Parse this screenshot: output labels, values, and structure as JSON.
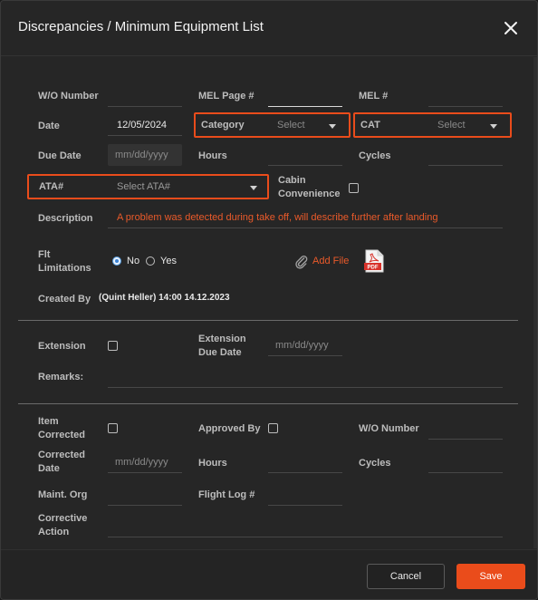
{
  "modal": {
    "title": "Discrepancies / Minimum Equipment List",
    "close_icon": "close-icon"
  },
  "form": {
    "wo_number_label": "W/O Number",
    "mel_page_label": "MEL Page #",
    "mel_number_label": "MEL #",
    "date_label": "Date",
    "date_value": "12/05/2024",
    "category_label": "Category",
    "category_value": "Select",
    "cat_label": "CAT",
    "cat_value": "Select",
    "due_date_label": "Due Date",
    "due_date_placeholder": "mm/dd/yyyy",
    "hours_label": "Hours",
    "cycles_label": "Cycles",
    "ata_label": "ATA#",
    "ata_value": "Select ATA#",
    "cabin_label": "Cabin Convenience",
    "description_label": "Description",
    "description_value": "A problem was detected during take off, will describe further after landing",
    "flt_label": "Flt Limitations",
    "no_label": "No",
    "yes_label": "Yes",
    "flt_selected": "No",
    "add_file_label": "Add File",
    "pdf_icon_text": "PDF",
    "created_by_label": "Created By",
    "created_by_value": "(Quint Heller) 14:00 14.12.2023"
  },
  "extension": {
    "extension_label": "Extension",
    "extension_due_label": "Extension Due Date",
    "extension_due_placeholder": "mm/dd/yyyy",
    "remarks_label": "Remarks:"
  },
  "correction": {
    "item_corrected_label": "Item Corrected",
    "approved_by_label": "Approved By",
    "wo_number_label": "W/O Number",
    "corrected_date_label": "Corrected Date",
    "corrected_date_placeholder": "mm/dd/yyyy",
    "hours_label": "Hours",
    "cycles_label": "Cycles",
    "maint_org_label": "Maint. Org",
    "flight_log_label": "Flight Log #",
    "corrective_action_label": "Corrective Action"
  },
  "footer": {
    "cancel_label": "Cancel",
    "save_label": "Save"
  },
  "colors": {
    "accent": "#ea4c1b",
    "background": "#262626",
    "text": "#e9e9e9",
    "label": "#bdbdbd",
    "radio_selected": "#3b82d4"
  }
}
